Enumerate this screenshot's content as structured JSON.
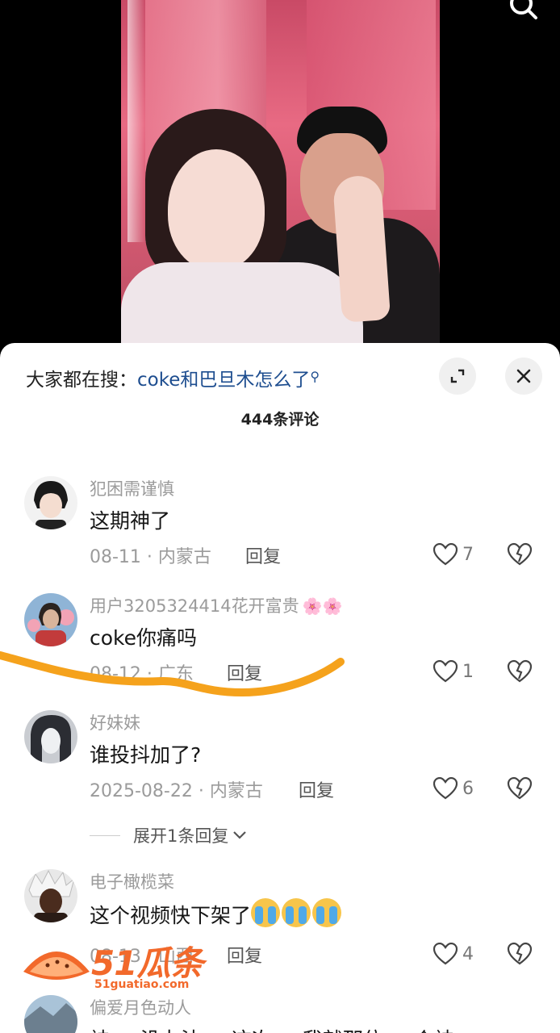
{
  "search_hint": {
    "prefix": "大家都在搜：",
    "query": "coke和巴旦木怎么了"
  },
  "comment_count": "444条评论",
  "comments": [
    {
      "username": "犯困需谨慎",
      "text": "这期神了",
      "date": "08-11",
      "location": "内蒙古",
      "reply_label": "回复",
      "likes": "7",
      "avatar_icon": "anime-boy-avatar"
    },
    {
      "username": "用户3205324414花开富贵",
      "username_decoration": "🌸🌸",
      "text": "coke你痛吗",
      "date": "08-12",
      "location": "广东",
      "reply_label": "回复",
      "likes": "1",
      "avatar_icon": "woman-flowers-avatar"
    },
    {
      "username": "好妹妹",
      "text": "谁投抖加了?",
      "date": "2025-08-22",
      "location": "内蒙古",
      "reply_label": "回复",
      "likes": "6",
      "avatar_icon": "pale-face-avatar"
    },
    {
      "username": "电子橄榄菜",
      "text": "这个视频快下架了",
      "date": "08-13",
      "location": "山西",
      "reply_label": "回复",
      "likes": "4",
      "avatar_icon": "white-hair-avatar"
    },
    {
      "username": "偏爱月色动人",
      "text": "神 没办法 这次 我就那位 个神",
      "avatar_icon": "landscape-avatar"
    }
  ],
  "expand_replies_label": "展开1条回复",
  "watermark": {
    "title": "51瓜条",
    "url": "51guatiao.com"
  },
  "colors": {
    "accent_query": "#1d4d8f",
    "highlight_stroke": "#f5a21c",
    "watermark": "#f2692b"
  }
}
